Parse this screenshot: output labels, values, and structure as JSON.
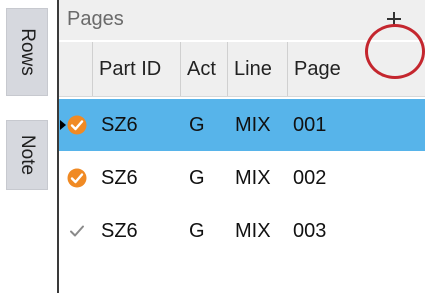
{
  "side_tabs": [
    {
      "label": "Rows"
    },
    {
      "label": "Note"
    }
  ],
  "panel": {
    "title": "Pages"
  },
  "columns": [
    "Part ID",
    "Act",
    "Line",
    "Page"
  ],
  "rows": [
    {
      "part_id": "SZ6",
      "act": "G",
      "line": "MIX",
      "page": "001",
      "status_icon": "orange-check-circle-icon",
      "selected": true
    },
    {
      "part_id": "SZ6",
      "act": "G",
      "line": "MIX",
      "page": "002",
      "status_icon": "orange-check-circle-icon",
      "selected": false
    },
    {
      "part_id": "SZ6",
      "act": "G",
      "line": "MIX",
      "page": "003",
      "status_icon": "gray-checkmark-icon",
      "selected": false
    }
  ],
  "colors": {
    "selected_row": "#57b4ea",
    "status_orange": "#f08a24",
    "highlight_circle": "#c4262e"
  }
}
